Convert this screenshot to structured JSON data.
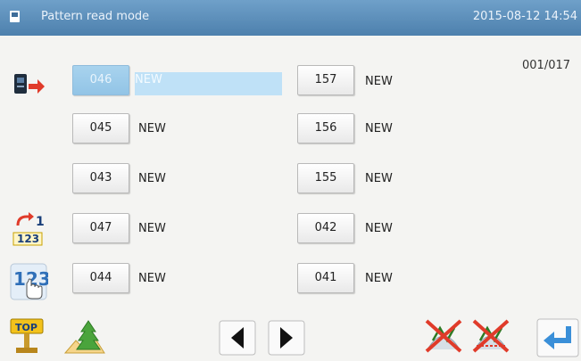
{
  "header": {
    "title": "Pattern read mode",
    "datetime": "2015-08-12 14:54"
  },
  "pagination": {
    "counter": "001/017"
  },
  "patterns": {
    "left": [
      {
        "number": "046",
        "name": "NEW",
        "selected": true
      },
      {
        "number": "045",
        "name": "NEW"
      },
      {
        "number": "043",
        "name": "NEW"
      },
      {
        "number": "047",
        "name": "NEW"
      },
      {
        "number": "044",
        "name": "NEW"
      }
    ],
    "right": [
      {
        "number": "157",
        "name": "NEW"
      },
      {
        "number": "156",
        "name": "NEW"
      },
      {
        "number": "155",
        "name": "NEW"
      },
      {
        "number": "042",
        "name": "NEW"
      },
      {
        "number": "041",
        "name": "NEW"
      }
    ]
  },
  "side_icons": {
    "read_icon": "card-arrow-icon",
    "sort_icon": "sort-123-icon",
    "numeric_input_icon": "hand-123-icon"
  },
  "sort_labels": {
    "top": "1",
    "bottom": "123"
  },
  "numeric_label": "123",
  "toolbar": {
    "top_label": "TOP",
    "tree_icon": "tree-image-icon",
    "prev_icon": "triangle-left-icon",
    "next_icon": "triangle-right-icon",
    "delete_icon_1": "delete-pattern-icon",
    "delete_icon_2": "delete-all-icon",
    "enter_icon": "return-arrow-icon"
  },
  "colors": {
    "title_bar": "#5a8bb8",
    "selected": "#a8d3ee",
    "accent_red": "#e03b2a",
    "enter_blue": "#3a8fd8"
  }
}
